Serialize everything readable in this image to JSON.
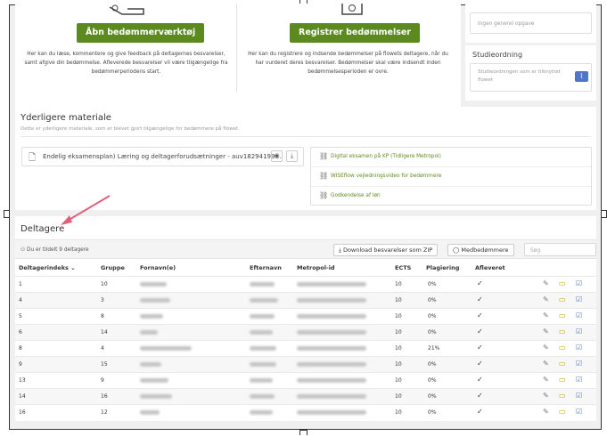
{
  "top_left": {
    "button_label": "Åbn bedømmerværktøj",
    "description": "Her kan du læse, kommentere og give feedback på deltagernes besvarelser, samt afgive din bedømmelse. Afleverede besvarelser vil være tilgængelige fra bedømmerperiodens start."
  },
  "top_middle": {
    "button_label": "Registrer bedømmelser",
    "description": "Her kan du registrere og indsende bedømmelser på flowets deltagere, når du har vurderet deres besvarelser. Bedømmelser skal være indsendt inden bedømmelsesperioden er ovre."
  },
  "right_panel": {
    "input_text": "Ingen generel opgave",
    "study_title": "Studieordning",
    "study_text": "Studieordningen som er tilknyttet flowet"
  },
  "material": {
    "title": "Yderligere materiale",
    "subtitle": "Dette er yderligere materiale, som er blevet gjort tilgængelige for bedømmere på flowet.",
    "file_label": "Endelig eksamensplan) Læring og deltagerforudsætninger - auv18294199…",
    "links": [
      "Digital eksamen på KP (Tidligere Metropol)",
      "WISEflow vejledningsvideo for bedømmere",
      "Godkendelse af løn"
    ]
  },
  "participants": {
    "title": "Deltagere",
    "count_text": "Du er tildelt 9 deltagere",
    "download_label": "Download besvarelser som ZIP",
    "co_assessor_label": "Medbedømmere",
    "search_placeholder": "Søg",
    "columns": [
      "Deltagerindeks",
      "Gruppe",
      "Fornavn(e)",
      "Efternavn",
      "Metropol-id",
      "ECTS",
      "Plagiering",
      "Afleveret"
    ],
    "rows": [
      {
        "index": "1",
        "group": "10",
        "ects": "10",
        "plag": "0%",
        "done": "✓"
      },
      {
        "index": "4",
        "group": "3",
        "ects": "10",
        "plag": "0%",
        "done": "✓"
      },
      {
        "index": "5",
        "group": "8",
        "ects": "10",
        "plag": "0%",
        "done": "✓"
      },
      {
        "index": "6",
        "group": "14",
        "ects": "10",
        "plag": "0%",
        "done": "✓"
      },
      {
        "index": "8",
        "group": "4",
        "ects": "10",
        "plag": "21%",
        "done": "✓"
      },
      {
        "index": "9",
        "group": "15",
        "ects": "10",
        "plag": "0%",
        "done": "✓"
      },
      {
        "index": "13",
        "group": "9",
        "ects": "10",
        "plag": "0%",
        "done": "✓"
      },
      {
        "index": "14",
        "group": "16",
        "ects": "10",
        "plag": "0%",
        "done": "✓"
      },
      {
        "index": "16",
        "group": "12",
        "ects": "10",
        "plag": "0%",
        "done": "✓"
      }
    ]
  },
  "colors": {
    "accent_green": "#5c8a1e",
    "accent_blue": "#4f77c7",
    "annotation_arrow": "#e0627a"
  }
}
